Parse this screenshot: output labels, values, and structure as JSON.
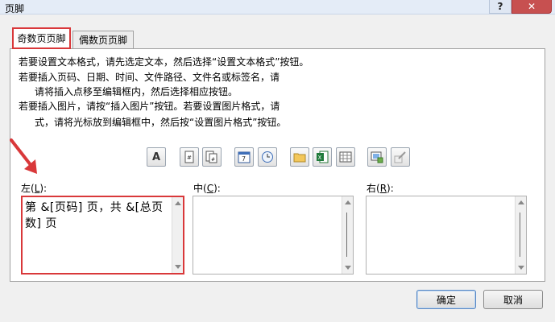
{
  "window": {
    "title": "页脚",
    "help": "?",
    "close": "✕"
  },
  "tabs": [
    {
      "label": "奇数页页脚",
      "selected": true
    },
    {
      "label": "偶数页页脚",
      "selected": false
    }
  ],
  "instructions": [
    "若要设置文本格式，请先选定文本，然后选择“设置文本格式”按钮。",
    "若要插入页码、日期、时间、文件路径、文件名或标签名，请",
    "请将插入点移至编辑框内，然后选择相应按钮。",
    "若要插入图片，请按“插入图片”按钮。若要设置图片格式，请",
    "式，请将光标放到编辑框中，然后按“设置图片格式”按钮。"
  ],
  "toolbar": {
    "format_text_label": "A",
    "icons": [
      "format-text-icon",
      "page-number-icon",
      "page-count-icon",
      "date-icon",
      "time-icon",
      "file-path-icon",
      "file-name-icon",
      "sheet-name-icon",
      "insert-picture-icon",
      "format-picture-icon"
    ]
  },
  "sections": {
    "left": {
      "label": "左(",
      "key": "L",
      "suffix": "):",
      "content": "第 &[页码] 页，共 &[总页数] 页"
    },
    "center": {
      "label": "中(",
      "key": "C",
      "suffix": "):",
      "content": ""
    },
    "right": {
      "label": "右(",
      "key": "R",
      "suffix": "):",
      "content": ""
    }
  },
  "buttons": {
    "ok": "确定",
    "cancel": "取消"
  },
  "colors": {
    "highlight": "#d9383a",
    "titlebar": "#e4ecf7",
    "close": "#c75050"
  }
}
